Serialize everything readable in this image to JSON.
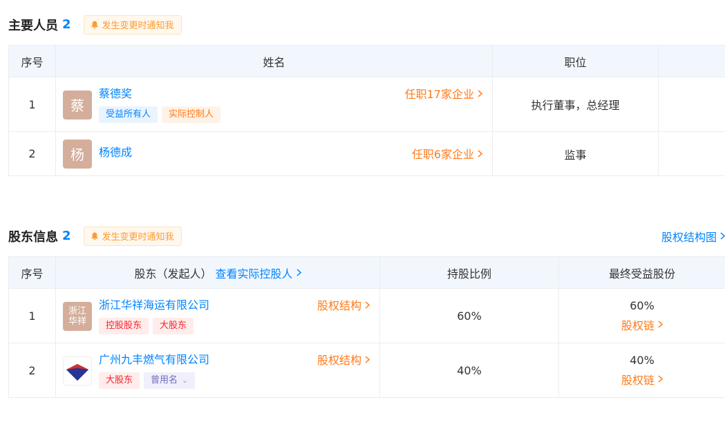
{
  "people": {
    "title": "主要人员",
    "count": "2",
    "notify_label": "发生变更时通知我",
    "columns": [
      "序号",
      "姓名",
      "职位"
    ],
    "rows": [
      {
        "no": "1",
        "avatar": "蔡",
        "name": "蔡德奖",
        "tags": [
          "受益所有人",
          "实际控制人"
        ],
        "link": "任职17家企业",
        "position": "执行董事，总经理"
      },
      {
        "no": "2",
        "avatar": "杨",
        "name": "杨德成",
        "tags": [],
        "link": "任职6家企业",
        "position": "监事"
      }
    ]
  },
  "shareholders": {
    "title": "股东信息",
    "count": "2",
    "notify_label": "发生变更时通知我",
    "structure_link": "股权结构图",
    "columns": {
      "no": "序号",
      "holder": "股东（发起人）",
      "holder_link": "查看实际控股人",
      "ratio": "持股比例",
      "final": "最终受益股份"
    },
    "rows": [
      {
        "no": "1",
        "avatar": "浙江华祥",
        "name": "浙江华祥海运有限公司",
        "tags": [
          "控股股东",
          "大股东"
        ],
        "link": "股权结构",
        "ratio": "60%",
        "final": "60%",
        "chain": "股权链"
      },
      {
        "no": "2",
        "avatar_icon": "triangle-logo",
        "name": "广州九丰燃气有限公司",
        "tags": [
          "大股东",
          "曾用名"
        ],
        "link": "股权结构",
        "ratio": "40%",
        "final": "40%",
        "chain": "股权链"
      }
    ]
  },
  "colors": {
    "accent_blue": "#0084ff",
    "accent_orange": "#ff7a1a",
    "header_bg": "#f2f7fe",
    "avatar_bg": "#d4ae9b"
  }
}
